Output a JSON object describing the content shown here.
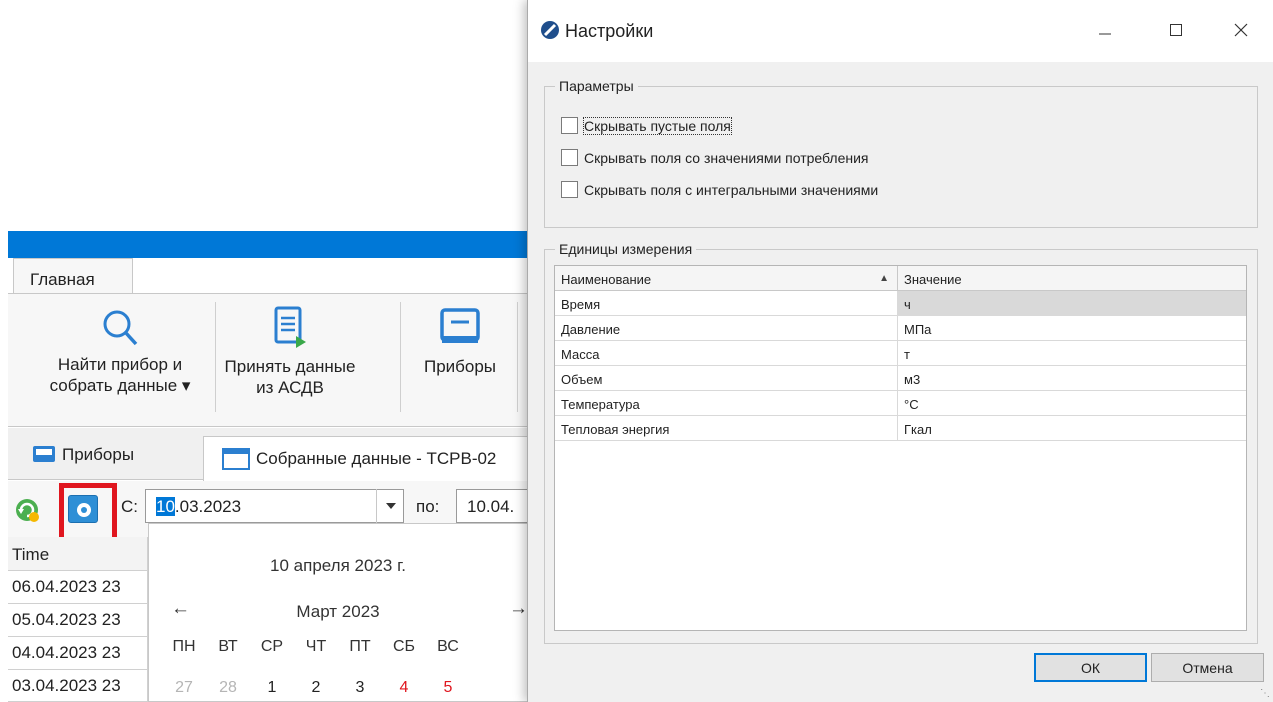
{
  "app": {
    "ribbon_tab": "Главная",
    "ribbon": {
      "find_device": [
        "Найти прибор и",
        "собрать данные ▾"
      ],
      "receive_data": [
        "Принять данные",
        "из АСДВ"
      ],
      "devices": "Приборы"
    },
    "doc_tabs": {
      "devices": "Приборы",
      "collected": "Собранные данные - ТСРВ-02"
    },
    "toolbar": {
      "from_label": "С:",
      "from_date_selected": "10",
      "from_date_rest": ".03.2023",
      "to_label": "по:",
      "to_date": "10.04."
    },
    "grid": {
      "header": "Time",
      "rows": [
        "06.04.2023 23",
        "05.04.2023 23",
        "04.04.2023 23",
        "03.04.2023 23"
      ]
    },
    "calendar": {
      "today": "10 апреля 2023 г.",
      "month": "Март 2023",
      "weekdays": [
        "ПН",
        "ВТ",
        "СР",
        "ЧТ",
        "ПТ",
        "СБ",
        "ВС"
      ],
      "first_row": [
        "27",
        "28",
        "1",
        "2",
        "3",
        "4",
        "5"
      ]
    }
  },
  "dialog": {
    "title": "Настройки",
    "params_group": "Параметры",
    "checkboxes": [
      {
        "label": "Скрывать пустые поля",
        "checked": false
      },
      {
        "label": "Скрывать поля со значениями потребления",
        "checked": false
      },
      {
        "label": "Скрывать поля с интегральными значениями",
        "checked": false
      }
    ],
    "units_group": "Единицы измерения",
    "table": {
      "col_name": "Наименование",
      "col_value": "Значение",
      "rows": [
        {
          "name": "Время",
          "value": "ч"
        },
        {
          "name": "Давление",
          "value": "МПа"
        },
        {
          "name": "Масса",
          "value": "т"
        },
        {
          "name": "Объем",
          "value": "м3"
        },
        {
          "name": "Температура",
          "value": "°C"
        },
        {
          "name": "Тепловая энергия",
          "value": "Гкал"
        }
      ]
    },
    "ok_label": "ОК",
    "cancel_label": "Отмена"
  },
  "colors": {
    "accent": "#0078d7",
    "highlight": "#e0161f"
  }
}
